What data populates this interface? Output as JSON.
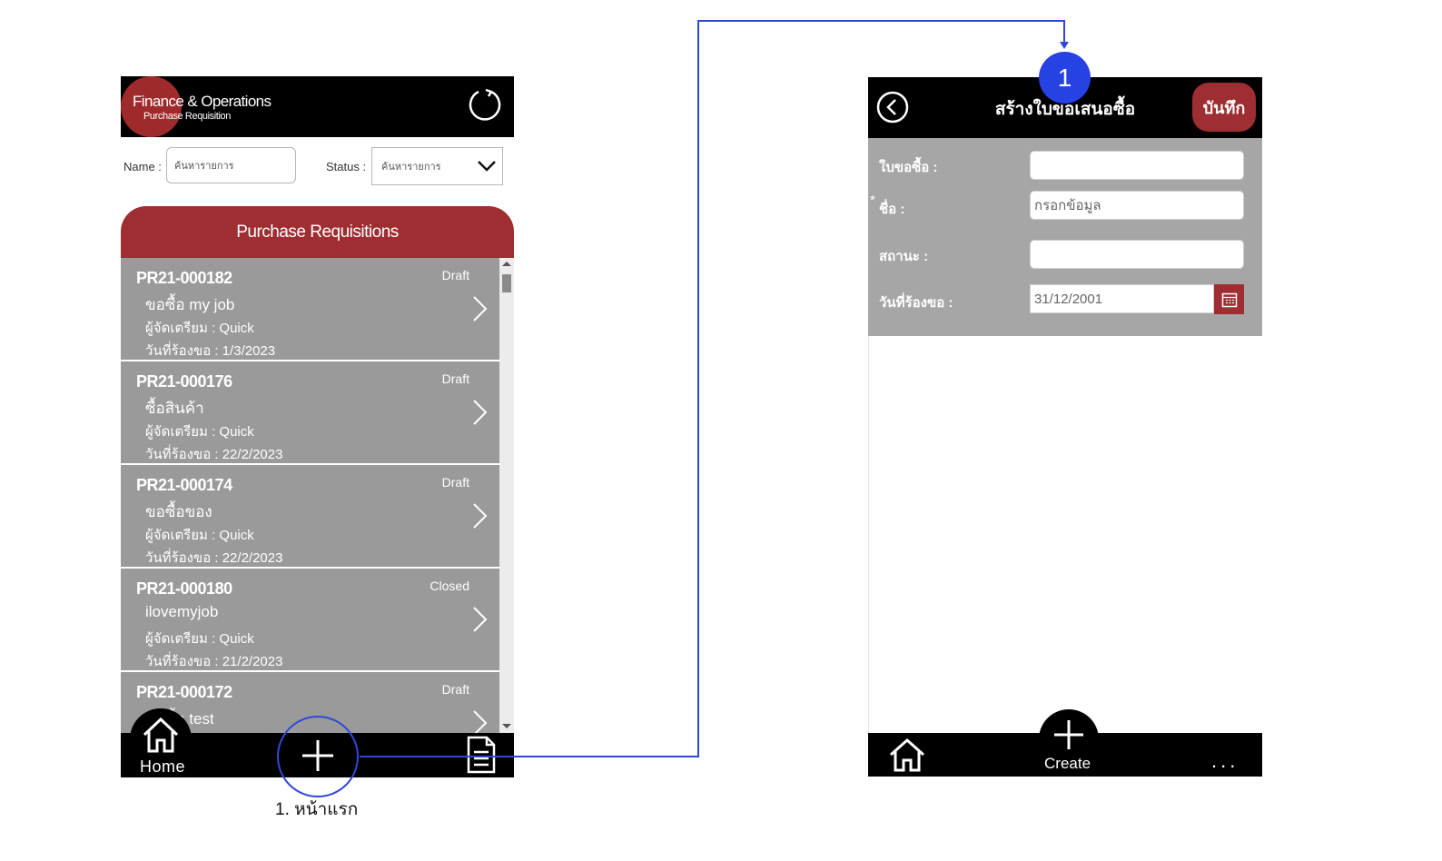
{
  "list_screen": {
    "brand_title": "Finance & Operations",
    "brand_subtitle": "Purchase Requisition",
    "name_label": "Name :",
    "name_placeholder": "ค้นหารายการ",
    "status_label": "Status :",
    "status_value": "ค้นหารายการ",
    "list_title": "Purchase Requisitions",
    "items": [
      {
        "id": "PR21-000182",
        "status": "Draft",
        "desc": "ขอซื้อ my job",
        "prepared": "ผู้จัดเตรียม : Quick",
        "date": "วันที่ร้องขอ : 1/3/2023"
      },
      {
        "id": "PR21-000176",
        "status": "Draft",
        "desc": "ซื้อสินค้า",
        "prepared": "ผู้จัดเตรียม : Quick",
        "date": "วันที่ร้องขอ : 22/2/2023"
      },
      {
        "id": "PR21-000174",
        "status": "Draft",
        "desc": "ขอซื้อของ",
        "prepared": "ผู้จัดเตรียม : Quick",
        "date": "วันที่ร้องขอ : 22/2/2023"
      },
      {
        "id": "PR21-000180",
        "status": "Closed",
        "desc": "ilovemyjob",
        "prepared": "ผู้จัดเตรียม : Quick",
        "date": "วันที่ร้องขอ : 21/2/2023"
      },
      {
        "id": "PR21-000172",
        "status": "Draft",
        "desc": "ขอซื้อ test",
        "prepared": "",
        "date": ""
      }
    ],
    "nav_home_label": "Home"
  },
  "annotation": {
    "caption": "1. หน้าแรก",
    "step_number": "1"
  },
  "create_screen": {
    "title": "สร้างใบขอเสนอซื้อ",
    "save_label": "บันทึก",
    "fields": [
      {
        "label": "ใบขอซื้อ :",
        "value": ""
      },
      {
        "label": "ชื่อ :",
        "value": "กรอกข้อมูล",
        "required": true
      },
      {
        "label": "สถานะ :",
        "value": ""
      },
      {
        "label": "วันที่ร้องขอ :",
        "value": "31/12/2001"
      }
    ],
    "required_mark": "*",
    "nav_create_label": "Create",
    "nav_more_label": "..."
  },
  "colors": {
    "brand_red": "#9e2e31",
    "header_black": "#000000",
    "card_gray": "#9a9a9a",
    "form_gray": "#a6a6a6",
    "annotation_blue": "#2742e4"
  },
  "icons": {
    "refresh": "refresh-icon",
    "chevron": "chevron-right-icon",
    "home": "home-icon",
    "add": "plus-icon",
    "document": "document-icon",
    "back": "back-icon",
    "calendar": "calendar-icon",
    "more": "more-icon"
  }
}
